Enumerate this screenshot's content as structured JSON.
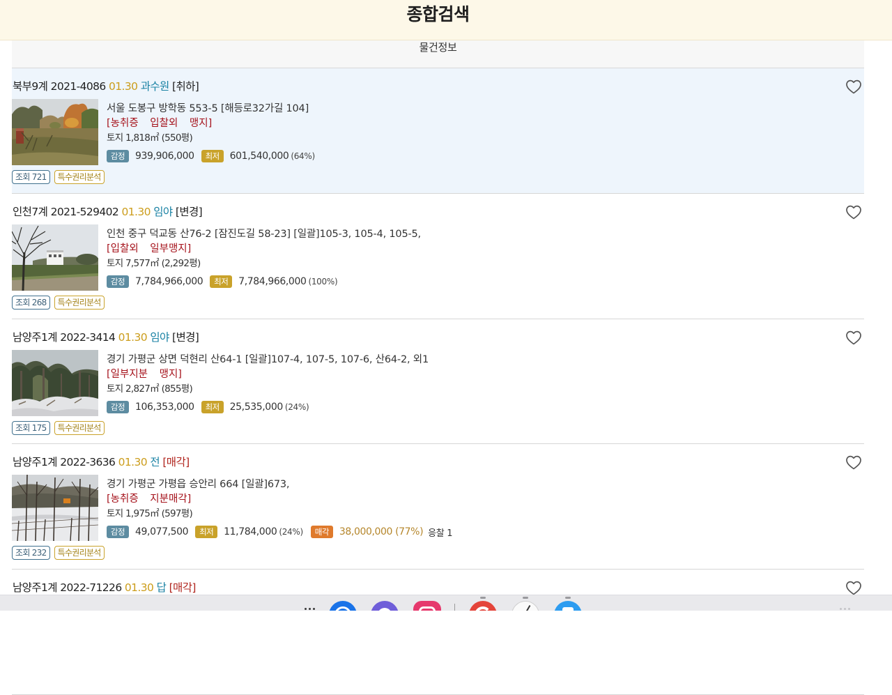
{
  "header": {
    "title": "종합검색"
  },
  "section": {
    "title": "물건정보"
  },
  "items": [
    {
      "case": "북부9계 2021-4086",
      "date": "01.30",
      "category": "과수원",
      "status": "[취하]",
      "address": "서울 도봉구 방학동 553-5 [해등로32가길 104]",
      "conditions": "[농취증 입찰외 맹지]",
      "land": "토지 1,818㎡ (550평)",
      "appraisal_label": "감정",
      "appraisal": "939,906,000",
      "minimum_label": "최저",
      "minimum": "601,540,000",
      "minimum_rate": "(64%)",
      "views": "조회 721",
      "analysis": "특수권리분석"
    },
    {
      "case": "인천7계 2021-529402",
      "date": "01.30",
      "category": "임야",
      "status": "[변경]",
      "address": "인천 중구 덕교동 산76-2 [잠진도길 58-23] [일괄]105-3, 105-4, 105-5,",
      "conditions": "[입찰외 일부맹지]",
      "land": "토지 7,577㎡ (2,292평)",
      "appraisal_label": "감정",
      "appraisal": "7,784,966,000",
      "minimum_label": "최저",
      "minimum": "7,784,966,000",
      "minimum_rate": "(100%)",
      "views": "조회 268",
      "analysis": "특수권리분석"
    },
    {
      "case": "남양주1계 2022-3414",
      "date": "01.30",
      "category": "임야",
      "status": "[변경]",
      "address": "경기 가평군 상면 덕현리 산64-1 [일괄]107-4, 107-5, 107-6, 산64-2, 외1",
      "conditions": "[일부지분 맹지]",
      "land": "토지 2,827㎡ (855평)",
      "appraisal_label": "감정",
      "appraisal": "106,353,000",
      "minimum_label": "최저",
      "minimum": "25,535,000",
      "minimum_rate": "(24%)",
      "views": "조회 175",
      "analysis": "특수권리분석"
    },
    {
      "case": "남양주1계 2022-3636",
      "date": "01.30",
      "category": "전",
      "status": "[매각]",
      "address": "경기 가평군 가평읍 승안리 664 [일괄]673,",
      "conditions": "[농취증 지분매각]",
      "land": "토지 1,975㎡ (597평)",
      "appraisal_label": "감정",
      "appraisal": "49,077,500",
      "minimum_label": "최저",
      "minimum": "11,784,000",
      "minimum_rate": "(24%)",
      "sale_label": "매각",
      "sale": "38,000,000 (77%)",
      "bids": "응찰 1",
      "views": "조회 232",
      "analysis": "특수권리분석"
    },
    {
      "case": "남양주1계 2022-71226",
      "date": "01.30",
      "category": "답",
      "status": "[매각]"
    }
  ],
  "colors": {
    "header_bg": "#fdf8e8",
    "selected_row": "#eef5fc",
    "date": "#cc9d1c",
    "category": "#1a82a4",
    "conditions": "#a5121b",
    "sold_status": "#b0241d",
    "appraisal_badge": "#5d8ca1",
    "minimum_badge": "#c9a22a",
    "sale_badge": "#df7a2c",
    "sale_price": "#b5862b"
  },
  "icons": {
    "favorite": "heart-outline-icon",
    "dock_menu": "more-dots-icon"
  }
}
